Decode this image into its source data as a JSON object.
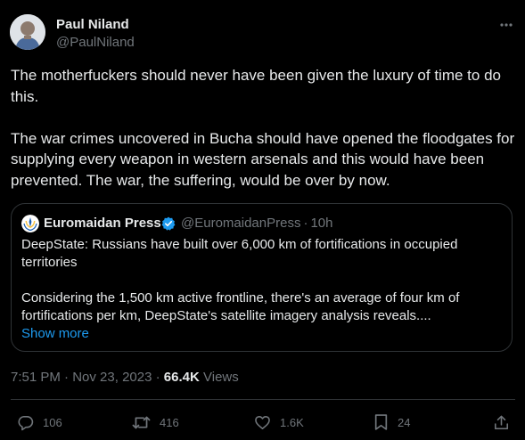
{
  "author": {
    "name": "Paul Niland",
    "handle": "@PaulNiland"
  },
  "tweet": {
    "paragraphs": [
      "The motherfuckers should never have been given the luxury of time to do this.",
      "The war crimes uncovered in Bucha should have opened the floodgates for supplying every weapon in western arsenals and this would have been prevented. The war, the suffering, would be over by now."
    ]
  },
  "quote": {
    "name": "Euromaidan Press",
    "handle": "@EuromaidanPress",
    "separator": "·",
    "time": "10h",
    "text1": "DeepState: Russians have built over 6,000 km of fortifications in occupied territories",
    "text2": "Considering the 1,500 km active frontline, there's an average of four km of fortifications per km, DeepState's satellite imagery analysis reveals....",
    "show_more": "Show more"
  },
  "meta": {
    "time": "7:51 PM",
    "sep": "·",
    "date": "Nov 23, 2023",
    "views_count": "66.4K",
    "views_label": "Views"
  },
  "actions": {
    "replies": "106",
    "reposts": "416",
    "likes": "1.6K",
    "bookmarks": "24"
  },
  "icons": [
    "more-icon",
    "verified-badge-icon",
    "reply-icon",
    "repost-icon",
    "like-icon",
    "bookmark-icon",
    "share-icon"
  ],
  "colors": {
    "background": "#000000",
    "text": "#e7e9ea",
    "secondary": "#71767b",
    "link": "#1d9bf0",
    "verified": "#1d9bf0",
    "border": "#2f3336"
  }
}
